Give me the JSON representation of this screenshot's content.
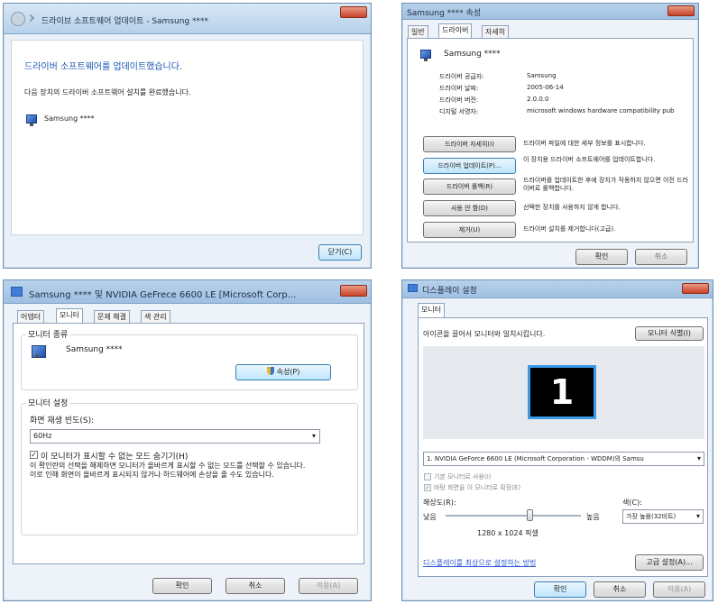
{
  "update_window": {
    "title": "드라이브 소프트웨어 업데이트 - Samsung ****",
    "heading": "드라이버 소프트웨어를 업데이트했습니다.",
    "message": "다음 장치의 드라이버 소프트웨어 설치를 완료했습니다.",
    "device_name": "Samsung ****",
    "close_label": "닫기(C)"
  },
  "properties_window": {
    "title": "Samsung **** 속성",
    "tabs": [
      "일반",
      "드라이버",
      "자세히"
    ],
    "device_name": "Samsung ****",
    "info_rows": [
      {
        "label": "드라이버 공급자:",
        "value": "Samsung"
      },
      {
        "label": "드라이버 날짜:",
        "value": "2005-06-14"
      },
      {
        "label": "드라이버 버전:",
        "value": "2.0.0.0"
      },
      {
        "label": "디지털 서명자:",
        "value": "microsoft windows hardware compatibility pub"
      }
    ],
    "actions": [
      {
        "button": "드라이버 자세히(I)",
        "desc": "드라이버 파일에 대한 세부 정보를 표시합니다."
      },
      {
        "button": "드라이버 업데이트(P)...",
        "desc": "이 장치용 드라이버 소프트웨어를 업데이트합니다."
      },
      {
        "button": "드라이버 롤백(R)",
        "desc": "드라이버를 업데이트한 후에 장치가 작동하지 않으면 이전 드라이버로 롤백합니다."
      },
      {
        "button": "사용 안 함(D)",
        "desc": "선택한 장치를 사용하지 않게 합니다."
      },
      {
        "button": "제거(U)",
        "desc": "드라이버 설치를 제거합니다(고급)."
      }
    ],
    "ok_label": "확인",
    "cancel_label": "취소"
  },
  "monitor_window": {
    "title": "Samsung **** 및 NVIDIA GeFrece 6600 LE [Microsoft Corp...",
    "tabs": [
      "어댑터",
      "모니터",
      "문제 해결",
      "색 관리"
    ],
    "group1_label": "모니터 종류",
    "device_name": "Samsung ****",
    "properties_label": "속성(P)",
    "group2_label": "모니터 설정",
    "refresh_label": "화면 재생 빈도(S):",
    "refresh_value": "60Hz",
    "hide_modes_label": "이 모니터가 표시할 수 없는 모드 숨기기(H)",
    "hide_modes_desc": "이 확인란의 선택을 해제하면 모니터가 올바르게 표시할 수 없는 모드를 선택할 수 있습니다. 이로 인해 화면이 올바르게 표시되지 않거나 하드웨어에 손상을 줄 수도 있습니다.",
    "ok_label": "확인",
    "cancel_label": "취소",
    "apply_label": "적용(A)"
  },
  "display_window": {
    "title": "디스플레이 설정",
    "tab": "모니터",
    "instruction": "아이콘을 끌어서 모니터와 일치시킵니다.",
    "identify_label": "모니터 식별(I)",
    "monitor_number": "1",
    "display_select": "1. NVIDIA GeForce 6600 LE (Microsoft Corporation - WDDM)의 Samsu",
    "check1": "기본 모니터로 사용(I)",
    "check2": "바탕 화면을 이 모니터로 확장(E)",
    "resolution_label": "해상도(R):",
    "low_label": "낮음",
    "high_label": "높음",
    "resolution_value": "1280 x 1024 픽셀",
    "resolution_level": 0.63,
    "colors_label": "색(C):",
    "colors_value": "가장 높음(32비트)",
    "help_link": "디스플레이를 최상으로 설정하는 방법",
    "advanced_label": "고급 설정(A)...",
    "ok_label": "확인",
    "cancel_label": "취소",
    "apply_label": "적용(A)"
  }
}
